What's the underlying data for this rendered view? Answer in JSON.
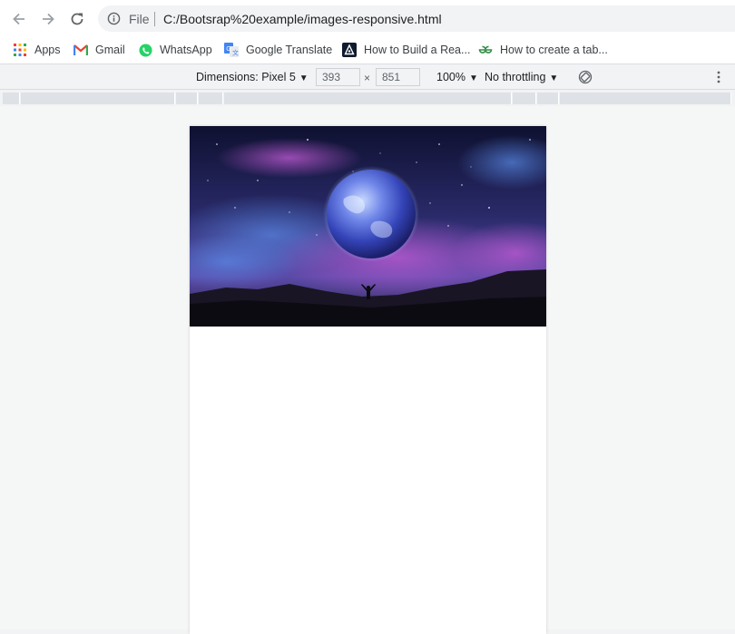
{
  "browser": {
    "scheme_label": "File",
    "url": "C:/Bootsrap%20example/images-responsive.html"
  },
  "bookmarks": [
    {
      "label": "Apps",
      "icon": "apps-grid-icon"
    },
    {
      "label": "Gmail",
      "icon": "gmail-icon"
    },
    {
      "label": "WhatsApp",
      "icon": "whatsapp-icon"
    },
    {
      "label": "Google Translate",
      "icon": "google-translate-icon"
    },
    {
      "label": "How to Build a Rea...",
      "icon": "dev-logo-icon"
    },
    {
      "label": "How to create a tab...",
      "icon": "geeks-logo-icon"
    }
  ],
  "device_toolbar": {
    "dimensions_label": "Dimensions: Pixel 5",
    "width": "393",
    "times": "×",
    "height": "851",
    "zoom": "100%",
    "throttling": "No throttling"
  },
  "page": {
    "image_description_alt": "Earth floating in a starry purple night sky above a silhouetted person on a hill"
  },
  "colors": {
    "accent_whatsapp": "#25d366",
    "toolbar_bg": "#ffffff",
    "devtools_bg": "#f1f3f4"
  }
}
